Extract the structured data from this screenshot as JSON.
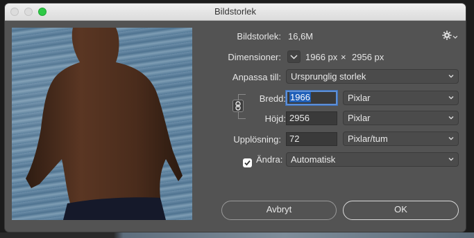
{
  "window": {
    "title": "Bildstorlek"
  },
  "info": {
    "size_label": "Bildstorlek:",
    "size_value": "16,6M",
    "dimensions_label": "Dimensioner:",
    "dim_width": "1966 px",
    "dim_times": "×",
    "dim_height": "2956 px"
  },
  "fit_to": {
    "label": "Anpassa till:",
    "value": "Ursprunglig storlek"
  },
  "width": {
    "label": "Bredd:",
    "value": "1966",
    "unit": "Pixlar"
  },
  "height": {
    "label": "Höjd:",
    "value": "2956",
    "unit": "Pixlar"
  },
  "resolution": {
    "label": "Upplösning:",
    "value": "72",
    "unit": "Pixlar/tum"
  },
  "resample": {
    "label": "Ändra:",
    "checked": true,
    "value": "Automatisk"
  },
  "buttons": {
    "cancel": "Avbryt",
    "ok": "OK"
  },
  "colors": {
    "accent": "#5d8fd6",
    "zoom_button": "#2ec946",
    "panel": "#535353"
  }
}
